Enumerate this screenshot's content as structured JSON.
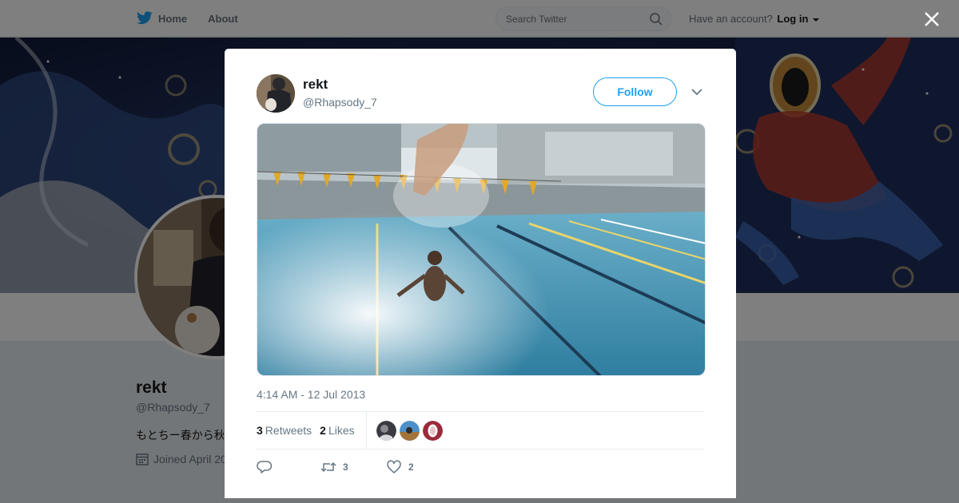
{
  "nav": {
    "home_label": "Home",
    "about_label": "About",
    "search_placeholder": "Search Twitter",
    "have_account": "Have an account?",
    "login_label": "Log in"
  },
  "profile": {
    "name": "rekt",
    "handle": "@Rhapsody_7",
    "bio": "もとちー春から秋",
    "joined": "Joined April 20"
  },
  "tweet": {
    "author_name": "rekt",
    "author_handle": "@Rhapsody_7",
    "follow_label": "Follow",
    "timestamp": "4:14 AM - 12 Jul 2013",
    "retweets_count": "3",
    "retweets_label": "Retweets",
    "likes_count": "2",
    "likes_label": "Likes",
    "reply_count": "",
    "retweet_action_count": "3",
    "like_action_count": "2"
  },
  "colors": {
    "accent": "#1da1f2",
    "text_primary": "#14171a",
    "text_secondary": "#657786"
  },
  "icons": [
    "twitter-bird-icon",
    "search-icon",
    "caret-down-icon",
    "close-icon",
    "chevron-down-icon",
    "calendar-icon",
    "reply-icon",
    "retweet-icon",
    "heart-icon"
  ]
}
